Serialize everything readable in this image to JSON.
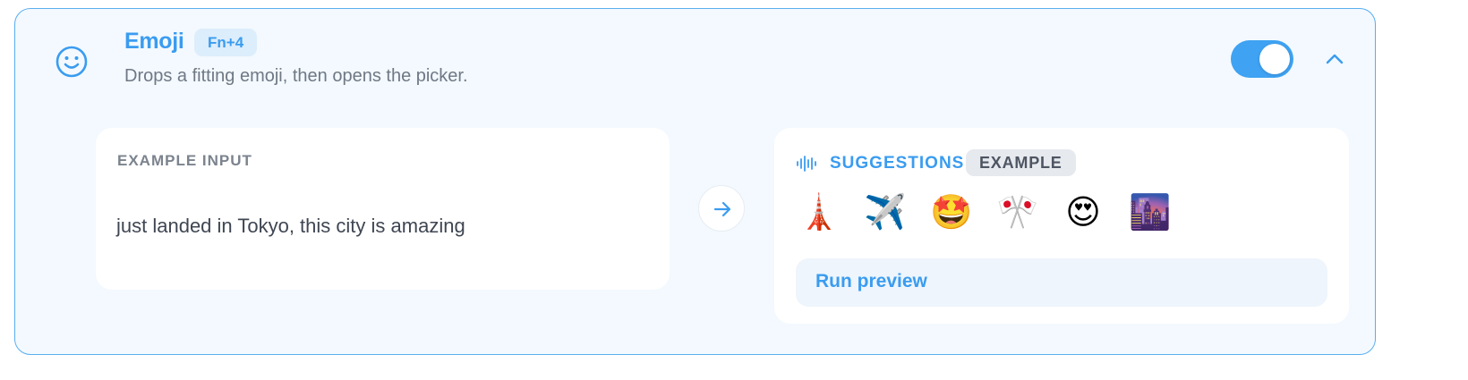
{
  "header": {
    "title": "Emoji",
    "shortcut": "Fn+4",
    "description": "Drops a fitting emoji, then opens the picker.",
    "enabled": true
  },
  "icons": {
    "feature": "smile-icon",
    "collapse": "chevron-up-icon",
    "arrow": "arrow-right-icon",
    "suggestions": "waveform-icon"
  },
  "input_panel": {
    "label": "EXAMPLE INPUT",
    "text": "just landed in Tokyo, this city is amazing"
  },
  "suggestions_panel": {
    "label": "SUGGESTIONS",
    "badge": "EXAMPLE",
    "emojis": [
      "🗼",
      "✈️",
      "🤩",
      "🎌",
      "😍",
      "🌆"
    ],
    "run_label": "Run preview"
  },
  "colors": {
    "accent": "#3a9cf0",
    "card_bg": "#f3f9fe",
    "card_border": "#5aaef0",
    "toggle_on": "#3fa2f2"
  }
}
